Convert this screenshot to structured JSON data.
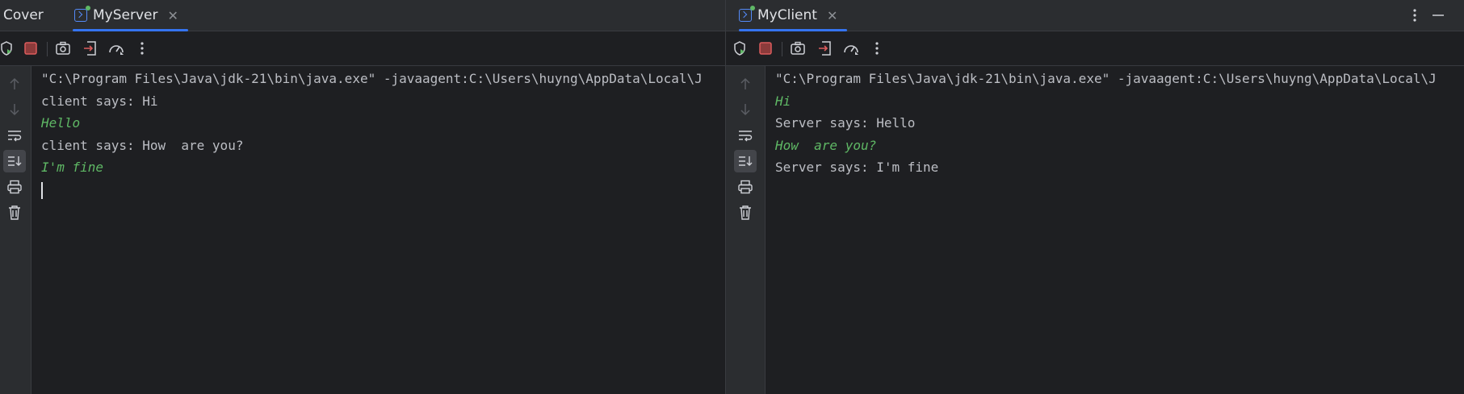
{
  "left_pane": {
    "tabs": [
      {
        "label": "Cover",
        "active": false
      },
      {
        "label": "MyServer",
        "active": true,
        "closable": true
      }
    ],
    "console": {
      "lines": [
        {
          "text": "\"C:\\Program Files\\Java\\jdk-21\\bin\\java.exe\" -javaagent:C:\\Users\\huyng\\AppData\\Local\\J",
          "kind": "out"
        },
        {
          "text": "client says: Hi",
          "kind": "out"
        },
        {
          "text": "Hello",
          "kind": "in"
        },
        {
          "text": "client says: How  are you?",
          "kind": "out"
        },
        {
          "text": "I'm fine",
          "kind": "in"
        }
      ]
    }
  },
  "right_pane": {
    "tabs": [
      {
        "label": "MyClient",
        "active": true,
        "closable": true
      }
    ],
    "console": {
      "lines": [
        {
          "text": "\"C:\\Program Files\\Java\\jdk-21\\bin\\java.exe\" -javaagent:C:\\Users\\huyng\\AppData\\Local\\J",
          "kind": "out"
        },
        {
          "text": "Hi",
          "kind": "in"
        },
        {
          "text": "Server says: Hello",
          "kind": "out"
        },
        {
          "text": "How  are you?",
          "kind": "in"
        },
        {
          "text": "Server says: I'm fine",
          "kind": "out"
        }
      ]
    }
  },
  "toolbar_icons": [
    "rerun-debug-icon",
    "stop-icon",
    "screenshot-icon",
    "exit-icon",
    "profiler-icon",
    "more-icon"
  ],
  "gutter_icons": [
    "scroll-up-icon",
    "scroll-down-icon",
    "soft-wrap-icon",
    "scroll-to-end-icon",
    "print-icon",
    "clear-all-icon"
  ],
  "colors": {
    "background": "#1e1f22",
    "panel": "#2b2d30",
    "accent": "#3574f0",
    "stdin_text": "#5fb865",
    "stdout_text": "#bcbec4",
    "stop_red": "#db5c5c"
  }
}
